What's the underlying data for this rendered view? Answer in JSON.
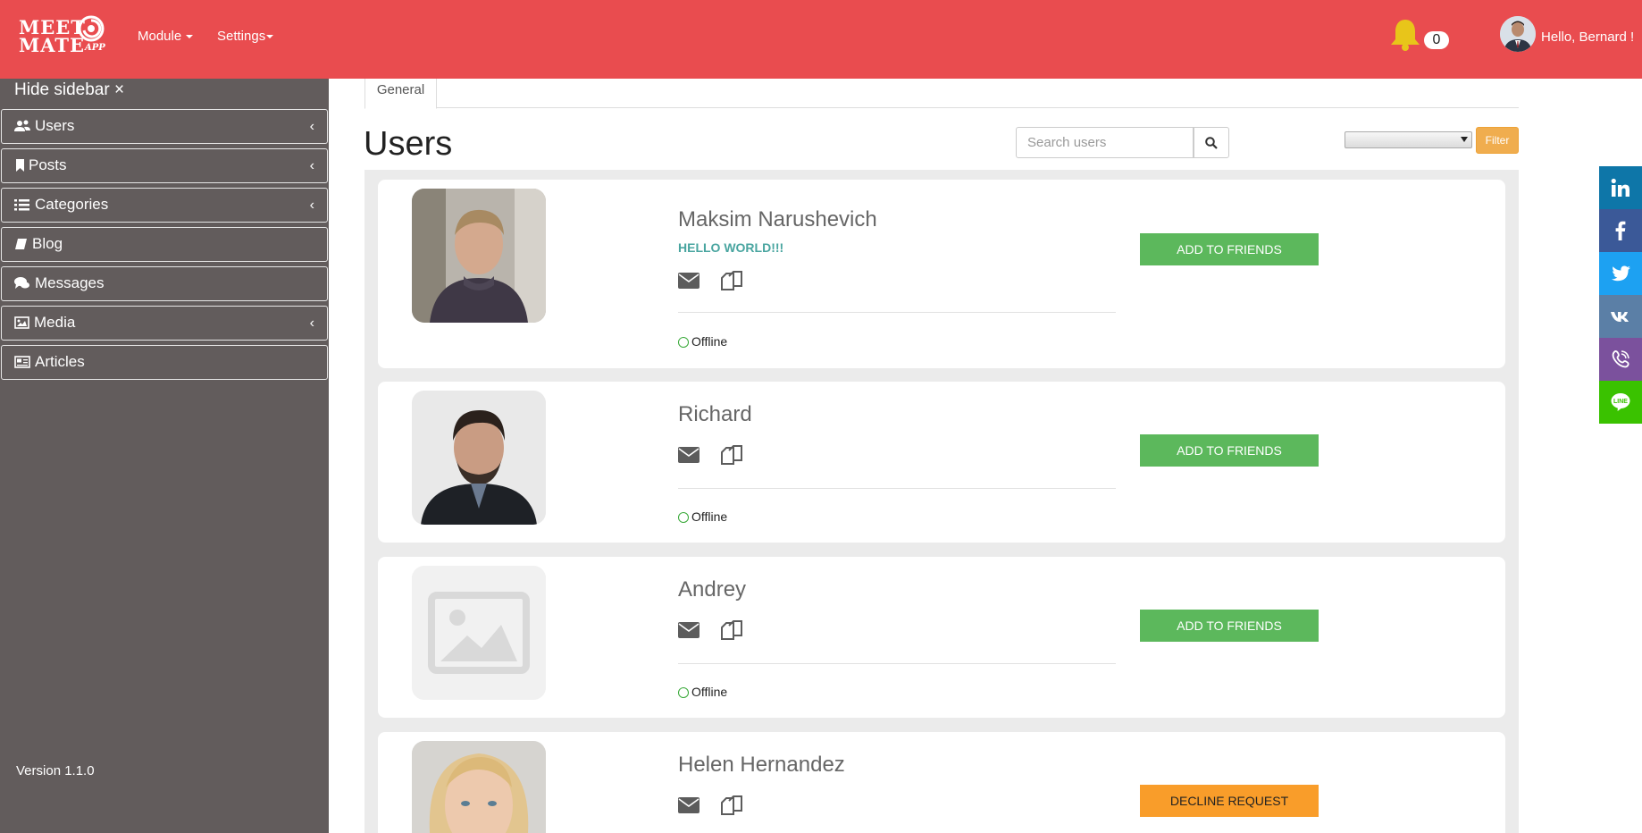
{
  "header": {
    "logo_line1": "MEET",
    "logo_line2": "MATE",
    "logo_app": "APP",
    "menu": [
      {
        "label": "Module"
      },
      {
        "label": "Settings"
      }
    ],
    "notification_count": "0",
    "greeting": "Hello, Bernard !"
  },
  "sidebar": {
    "hide_label": "Hide sidebar ×",
    "items": [
      {
        "label": "Users",
        "icon": "users-icon",
        "has_submenu": true
      },
      {
        "label": "Posts",
        "icon": "bookmark-icon",
        "has_submenu": true
      },
      {
        "label": "Categories",
        "icon": "list-icon",
        "has_submenu": true
      },
      {
        "label": "Blog",
        "icon": "book-icon",
        "has_submenu": false
      },
      {
        "label": "Messages",
        "icon": "comments-icon",
        "has_submenu": false
      },
      {
        "label": "Media",
        "icon": "image-icon",
        "has_submenu": true
      },
      {
        "label": "Articles",
        "icon": "newspaper-icon",
        "has_submenu": false
      }
    ],
    "chevron": "‹",
    "version": "Version 1.1.0"
  },
  "main": {
    "tabs": [
      {
        "label": "General"
      }
    ],
    "title": "Users",
    "search": {
      "placeholder": "Search users",
      "value": ""
    },
    "filter": {
      "selected": "",
      "button_label": "Filter"
    }
  },
  "users": [
    {
      "name": "Maksim Narushevich",
      "status_message": "HELLO WORLD!!!",
      "presence": "Offline",
      "action": "ADD TO FRIENDS"
    },
    {
      "name": "Richard",
      "status_message": "",
      "presence": "Offline",
      "action": "ADD TO FRIENDS"
    },
    {
      "name": "Andrey",
      "status_message": "",
      "presence": "Offline",
      "action": "ADD TO FRIENDS"
    },
    {
      "name": "Helen Hernandez",
      "status_message": "",
      "presence": "",
      "action": "DECLINE REQUEST"
    }
  ],
  "social": [
    {
      "icon": "linkedin-icon",
      "color": "#0e76a8"
    },
    {
      "icon": "facebook-icon",
      "color": "#3b5998"
    },
    {
      "icon": "twitter-icon",
      "color": "#1da1f2"
    },
    {
      "icon": "vk-icon",
      "color": "#5b7fa6"
    },
    {
      "icon": "viber-icon",
      "color": "#7b519d"
    },
    {
      "icon": "line-icon",
      "color": "#3ac200"
    }
  ],
  "colors": {
    "header": "#e94c4f",
    "sidebar": "#625c5c",
    "add_button": "#5cb85c",
    "decline_button": "#f99d2a",
    "filter_button": "#f0ad4e"
  }
}
